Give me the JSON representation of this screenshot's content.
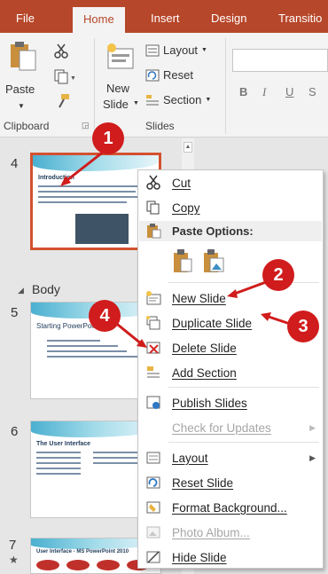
{
  "ribbon": {
    "tabs": [
      "File",
      "Home",
      "Insert",
      "Design",
      "Transitio"
    ],
    "paste_label": "Paste",
    "new_slide_label_1": "New",
    "new_slide_label_2": "Slide",
    "layout_label": "Layout",
    "reset_label": "Reset",
    "section_label": "Section",
    "bold": "B",
    "italic": "I",
    "underline": "U",
    "shadow": "S",
    "groups": [
      "Clipboard",
      "Slides"
    ]
  },
  "pane": {
    "section_label": "Body",
    "slides": [
      {
        "number": "4",
        "title": "Introduction"
      },
      {
        "number": "5",
        "title": "Starting PowerPoint"
      },
      {
        "number": "6",
        "title": "The User Interface"
      },
      {
        "number": "7",
        "title": "User Interface - MS PowerPoint 2010"
      }
    ],
    "star": "★"
  },
  "context_menu": {
    "items": [
      {
        "label": "Cut",
        "icon": "scissors-icon",
        "enabled": true
      },
      {
        "label": "Copy",
        "icon": "copy-icon",
        "enabled": true
      },
      {
        "label": "Paste Options:",
        "icon": "paste-icon",
        "enabled": true
      },
      {
        "label": "New Slide",
        "icon": "new-slide-icon",
        "enabled": true
      },
      {
        "label": "Duplicate Slide",
        "icon": "duplicate-slide-icon",
        "enabled": true
      },
      {
        "label": "Delete Slide",
        "icon": "delete-slide-icon",
        "enabled": true
      },
      {
        "label": "Add Section",
        "icon": "add-section-icon",
        "enabled": true
      },
      {
        "label": "Publish Slides",
        "icon": "publish-slides-icon",
        "enabled": true
      },
      {
        "label": "Check for Updates",
        "icon": "none",
        "enabled": false
      },
      {
        "label": "Layout",
        "icon": "layout-icon",
        "enabled": true
      },
      {
        "label": "Reset Slide",
        "icon": "reset-slide-icon",
        "enabled": true
      },
      {
        "label": "Format Background...",
        "icon": "format-background-icon",
        "enabled": true
      },
      {
        "label": "Photo Album...",
        "icon": "photo-album-icon",
        "enabled": false
      },
      {
        "label": "Hide Slide",
        "icon": "hide-slide-icon",
        "enabled": true
      }
    ]
  },
  "callouts": [
    "1",
    "2",
    "3",
    "4"
  ],
  "colors": {
    "accent": "#b7472a",
    "selection": "#d35230",
    "callout": "#d01c1c"
  }
}
